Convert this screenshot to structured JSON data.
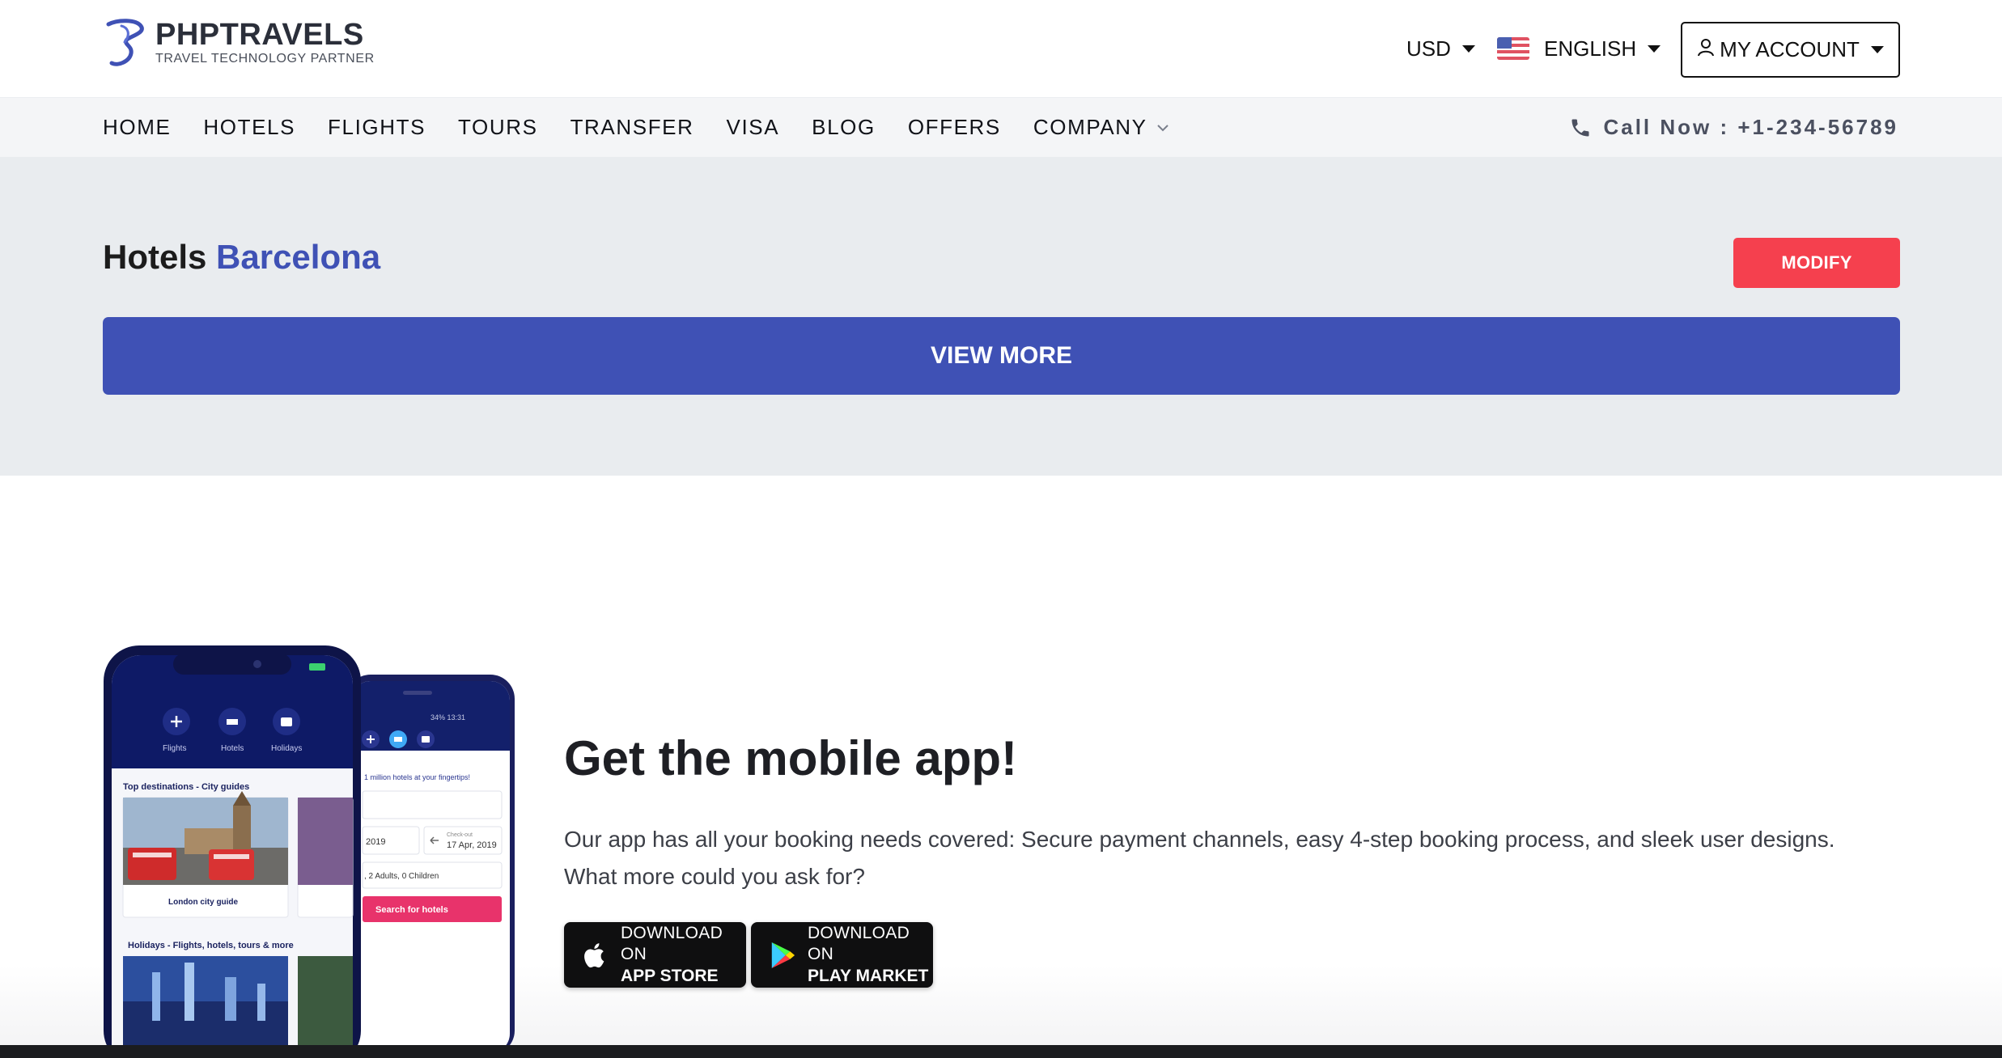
{
  "brand": {
    "name": "PHPTRAVELS",
    "tagline": "TRAVEL TECHNOLOGY PARTNER",
    "primary_color": "#3f51b5",
    "accent_color": "#f5404e"
  },
  "header": {
    "currency": "USD",
    "language": "ENGLISH",
    "language_flag_icon": "us-flag-icon",
    "account_label": "MY ACCOUNT"
  },
  "nav": {
    "items": [
      {
        "label": "HOME"
      },
      {
        "label": "HOTELS"
      },
      {
        "label": "FLIGHTS"
      },
      {
        "label": "TOURS"
      },
      {
        "label": "TRANSFER"
      },
      {
        "label": "VISA"
      },
      {
        "label": "BLOG"
      },
      {
        "label": "OFFERS"
      },
      {
        "label": "COMPANY"
      }
    ],
    "call_now": "Call Now : +1-234-56789"
  },
  "results": {
    "title_prefix": "Hotels",
    "title_city": "Barcelona",
    "modify_label": "MODIFY",
    "view_more_label": "VIEW MORE"
  },
  "app": {
    "title": "Get the mobile app!",
    "description": "Our app has all your booking needs covered: Secure payment channels, easy 4-step booking process, and sleek user designs. What more could you ask for?",
    "app_store": {
      "top": "DOWNLOAD ON",
      "bottom": "APP STORE"
    },
    "play_market": {
      "top": "DOWNLOAD ON",
      "bottom": "PLAY MARKET"
    }
  },
  "phone_mockup": {
    "front": {
      "tabs": [
        "Flights",
        "Hotels",
        "Holidays"
      ],
      "section1": "Top destinations - City guides",
      "card1": "London city guide",
      "section2": "Holidays - Flights, hotels, tours & more"
    },
    "back": {
      "status": "34% 13:31",
      "headline": "1 million hotels at your fingertips!",
      "checkin_date": "2019",
      "checkout_label": "Check-out",
      "checkout_date": "17 Apr, 2019",
      "guests": ", 2 Adults, 0 Children",
      "search_label": "Search for hotels"
    }
  }
}
